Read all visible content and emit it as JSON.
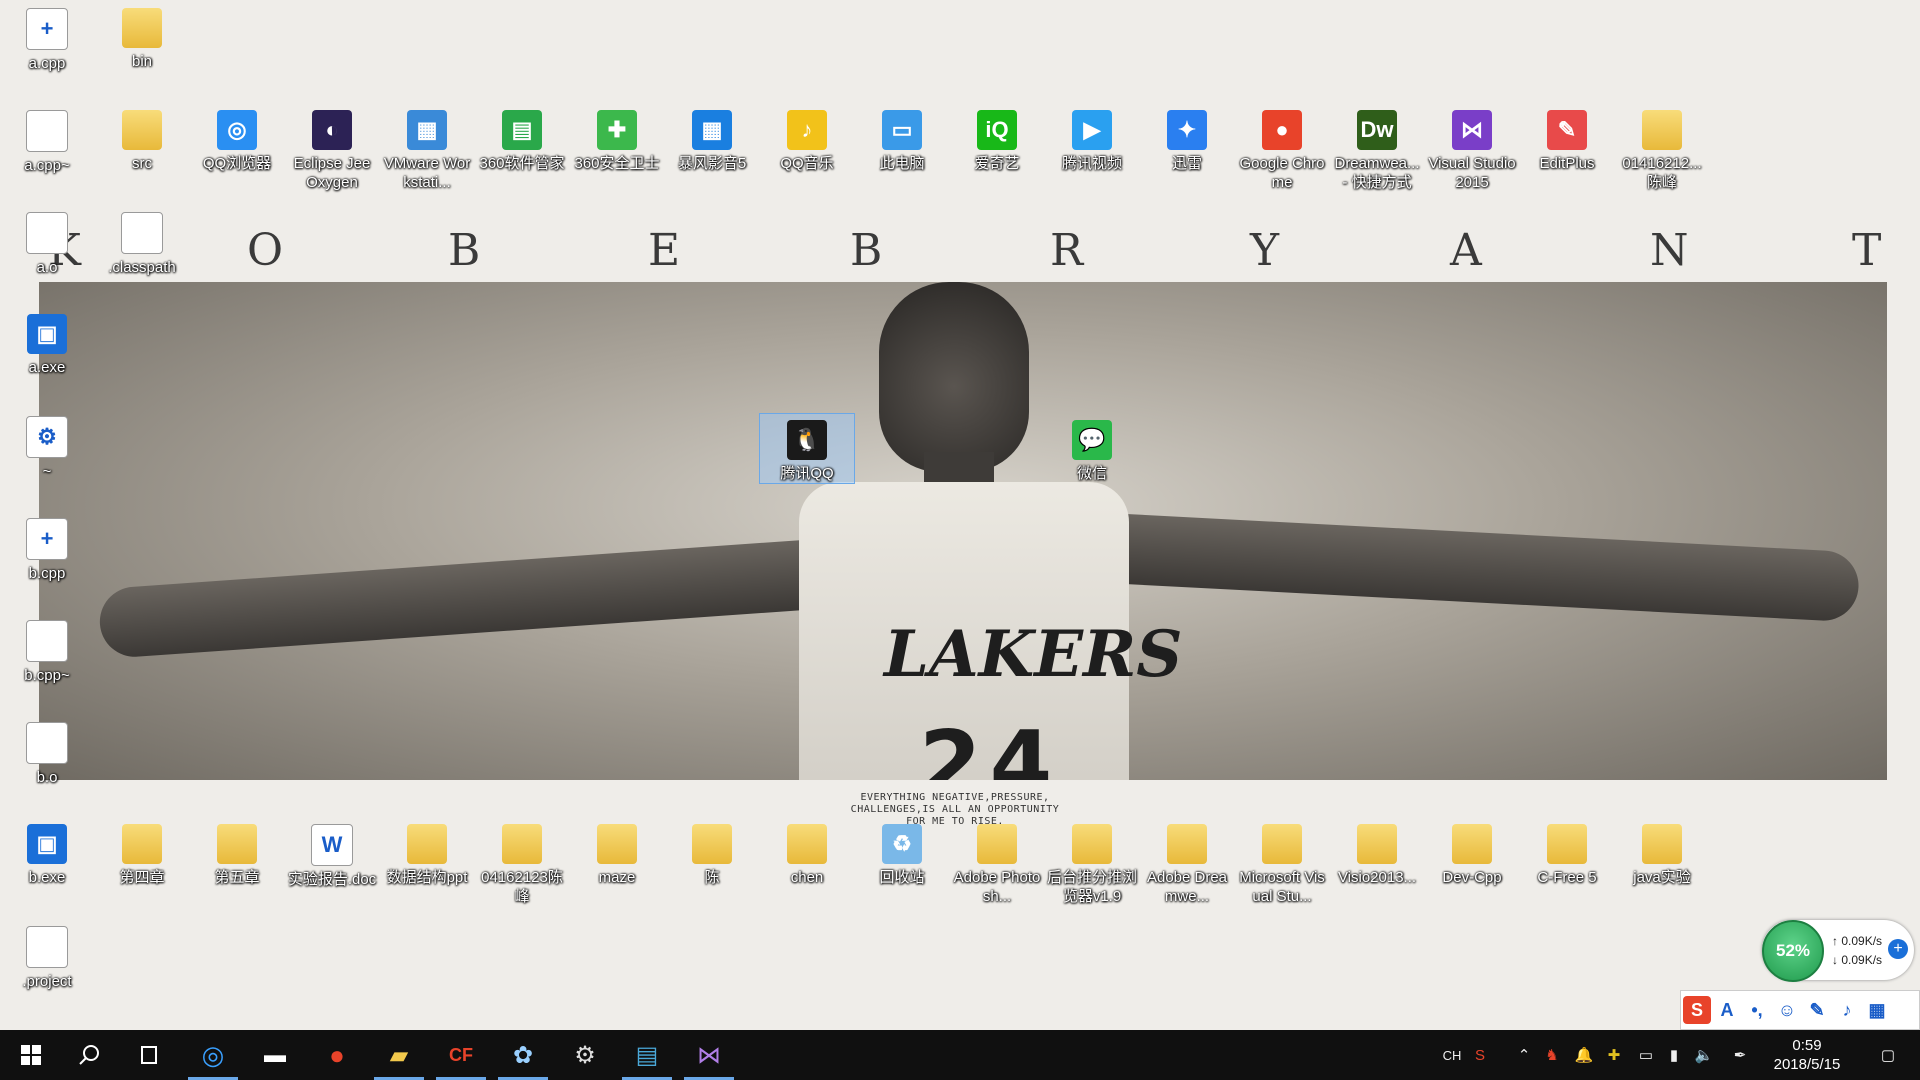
{
  "wallpaper": {
    "letters": [
      "K",
      "O",
      "B",
      "E",
      "B",
      "R",
      "Y",
      "A",
      "N",
      "T"
    ],
    "jersey_text": "LAKERS",
    "jersey_number": "24",
    "quote": "EVERYTHING NEGATIVE,PRESSURE,\nCHALLENGES,IS ALL AN OPPORTUNITY\nFOR ME TO RISE."
  },
  "desktop_icons": [
    {
      "label": "a.cpp",
      "icon": "cpp-file-icon"
    },
    {
      "label": "bin",
      "icon": "folder-icon"
    },
    {
      "label": "a.cpp~",
      "icon": "blank-file-icon"
    },
    {
      "label": "src",
      "icon": "folder-icon"
    },
    {
      "label": "QQ浏览器",
      "icon": "qq-browser-icon"
    },
    {
      "label": "Eclipse Jee Oxygen",
      "icon": "eclipse-icon"
    },
    {
      "label": "VMware Workstati...",
      "icon": "vmware-icon"
    },
    {
      "label": "360软件管家",
      "icon": "360-software-icon"
    },
    {
      "label": "360安全卫士",
      "icon": "360-security-icon"
    },
    {
      "label": "暴风影音5",
      "icon": "baofeng-icon"
    },
    {
      "label": "QQ音乐",
      "icon": "qq-music-icon"
    },
    {
      "label": "此电脑",
      "icon": "this-pc-icon"
    },
    {
      "label": "爱奇艺",
      "icon": "iqiyi-icon"
    },
    {
      "label": "腾讯视频",
      "icon": "tencent-video-icon"
    },
    {
      "label": "迅雷",
      "icon": "thunder-icon"
    },
    {
      "label": "Google Chrome",
      "icon": "chrome-icon"
    },
    {
      "label": "Dreamwea... - 快捷方式",
      "icon": "dreamweaver-icon"
    },
    {
      "label": "Visual Studio 2015",
      "icon": "visual-studio-icon"
    },
    {
      "label": "EditPlus",
      "icon": "editplus-icon"
    },
    {
      "label": "01416212... 陈峰",
      "icon": "zip-folder-icon"
    },
    {
      "label": "a.o",
      "icon": "blank-file-icon"
    },
    {
      "label": ".classpath",
      "icon": "blank-file-icon"
    },
    {
      "label": "a.exe",
      "icon": "exe-icon"
    },
    {
      "label": "~",
      "icon": "gear-file-icon"
    },
    {
      "label": "b.cpp",
      "icon": "cpp-file-icon"
    },
    {
      "label": "b.cpp~",
      "icon": "blank-file-icon"
    },
    {
      "label": "b.o",
      "icon": "blank-file-icon"
    },
    {
      "label": "腾讯QQ",
      "icon": "qq-icon"
    },
    {
      "label": "微信",
      "icon": "wechat-icon"
    },
    {
      "label": "b.exe",
      "icon": "exe-icon"
    },
    {
      "label": "第四章",
      "icon": "folder-icon"
    },
    {
      "label": "第五章",
      "icon": "folder-icon"
    },
    {
      "label": "实验报告.doc",
      "icon": "word-doc-icon"
    },
    {
      "label": "数据结构ppt",
      "icon": "folder-icon"
    },
    {
      "label": "04162123陈峰",
      "icon": "folder-icon"
    },
    {
      "label": "maze",
      "icon": "folder-icon"
    },
    {
      "label": "陈",
      "icon": "folder-icon"
    },
    {
      "label": "chen",
      "icon": "folder-icon"
    },
    {
      "label": "回收站",
      "icon": "recycle-bin-icon"
    },
    {
      "label": "Adobe Photosh...",
      "icon": "photoshop-folder-icon"
    },
    {
      "label": "后台推分推浏览器v1.9",
      "icon": "folder-icon"
    },
    {
      "label": "Adobe Dreamwe...",
      "icon": "folder-icon"
    },
    {
      "label": "Microsoft Visual Stu...",
      "icon": "folder-icon"
    },
    {
      "label": "Visio2013...",
      "icon": "folder-icon"
    },
    {
      "label": "Dev-Cpp",
      "icon": "folder-icon"
    },
    {
      "label": "C-Free 5",
      "icon": "folder-icon"
    },
    {
      "label": "java实验",
      "icon": "folder-icon"
    },
    {
      "label": ".project",
      "icon": "blank-file-icon"
    }
  ],
  "net_monitor": {
    "percent": "52%",
    "up": "0.09K/s",
    "down": "0.09K/s"
  },
  "taskbar": {
    "apps": [
      "start-icon",
      "search-icon",
      "task-view-icon",
      "qq-browser-icon",
      "terminal-icon",
      "chrome-icon",
      "file-explorer-icon",
      "cfree-icon",
      "paint-icon",
      "settings-icon",
      "winrar-icon",
      "visual-studio-icon"
    ],
    "ime": "CH",
    "time": "0:59",
    "date": "2018/5/15"
  },
  "colors": {
    "taskbar_bg": "#101010",
    "accent": "#6aa8e8",
    "desktop_bg": "#efede9"
  }
}
